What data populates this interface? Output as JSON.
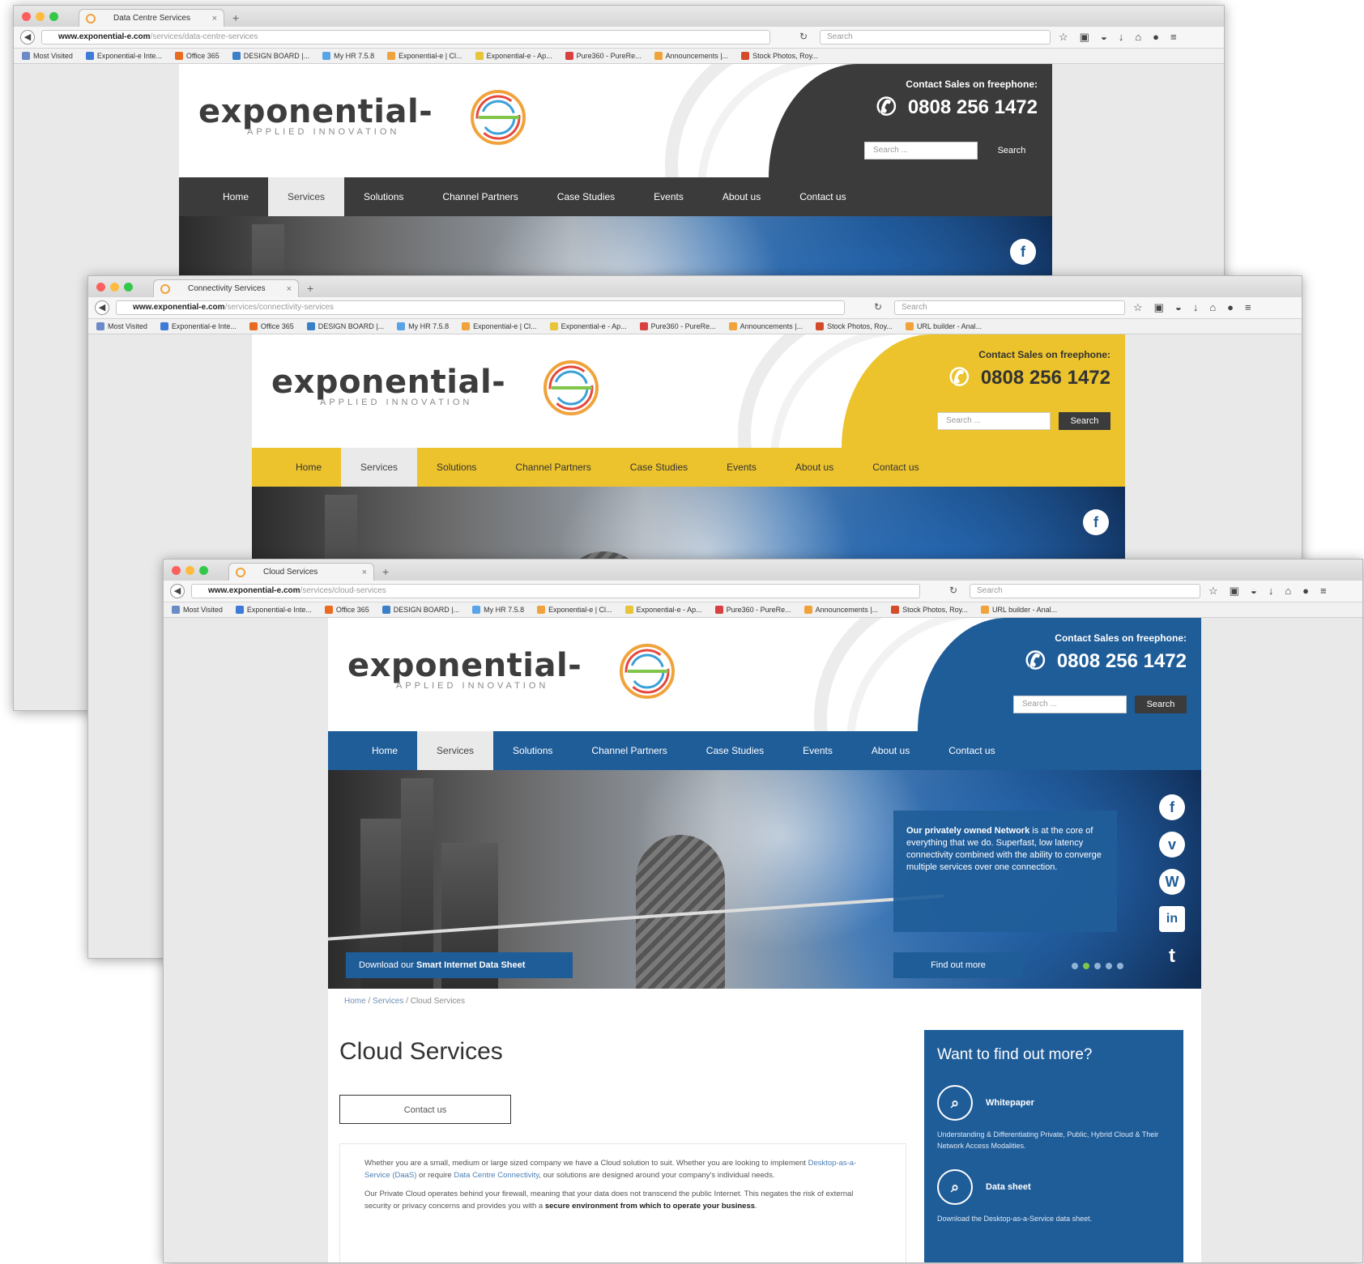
{
  "browser": {
    "bookmarks": [
      "Most Visited",
      "Exponential-e Inte...",
      "Office 365",
      "DESIGN BOARD |...",
      "My HR 7.5.8",
      "Exponential-e | Cl...",
      "Exponential-e - Ap...",
      "Pure360 - PureRe...",
      "Announcements |...",
      "Stock Photos, Roy...",
      "URL builder - Anal..."
    ],
    "search_placeholder": "Search",
    "url_domain": "www.exponential-e.com"
  },
  "windows": [
    {
      "tab_title": "Data Centre Services",
      "url_path": "/services/data-centre-services",
      "theme": "#3b3b3b"
    },
    {
      "tab_title": "Connectivity Services",
      "url_path": "/services/connectivity-services",
      "theme": "#ecc32c"
    },
    {
      "tab_title": "Cloud Services",
      "url_path": "/services/cloud-services",
      "theme": "#1f5d99"
    }
  ],
  "site": {
    "logo_text": "exponential-",
    "logo_tagline": "APPLIED INNOVATION",
    "contact_label": "Contact Sales on freephone:",
    "phone": "0808 256 1472",
    "search_placeholder": "Search ...",
    "search_button": "Search",
    "nav": [
      "Home",
      "Services",
      "Solutions",
      "Channel Partners",
      "Case Studies",
      "Events",
      "About us",
      "Contact us"
    ],
    "nav_active": "Services",
    "hero": {
      "box_bold": "Our privately owned Network",
      "box_text": " is at the core of everything that we do. Superfast, low latency connectivity combined with the ability to converge multiple services over one connection.",
      "cta_left_prefix": "Download our ",
      "cta_left_bold": "Smart Internet Data Sheet",
      "cta_right": "Find out more",
      "social": [
        "f",
        "v",
        "W",
        "in",
        "t"
      ]
    }
  },
  "page": {
    "breadcrumb": [
      "Home",
      "Services",
      "Cloud Services"
    ],
    "title": "Cloud Services",
    "contact_button": "Contact us",
    "para1_a": "Whether you are a small, medium or large sized company we have a Cloud solution to suit. Whether you are looking to implement ",
    "para1_link1": "Desktop-as-a-Service (DaaS)",
    "para1_b": " or require ",
    "para1_link2": "Data Centre Connectivity",
    "para1_c": ", our solutions are designed around your company's individual needs.",
    "para2_a": "Our Private Cloud operates behind your firewall, meaning that your data does not transcend the public Internet. This negates the risk of external security or privacy concerns and provides you with a ",
    "para2_bold": "secure environment from which to operate your business",
    "para2_c": ".",
    "sidebar": {
      "title": "Want to find out more?",
      "resources": [
        {
          "label": "Whitepaper",
          "desc": "Understanding & Differentiating Private, Public, Hybrid Cloud & Their Network Access Modalities."
        },
        {
          "label": "Data sheet",
          "desc": "Download the Desktop-as-a-Service data sheet."
        }
      ]
    }
  }
}
